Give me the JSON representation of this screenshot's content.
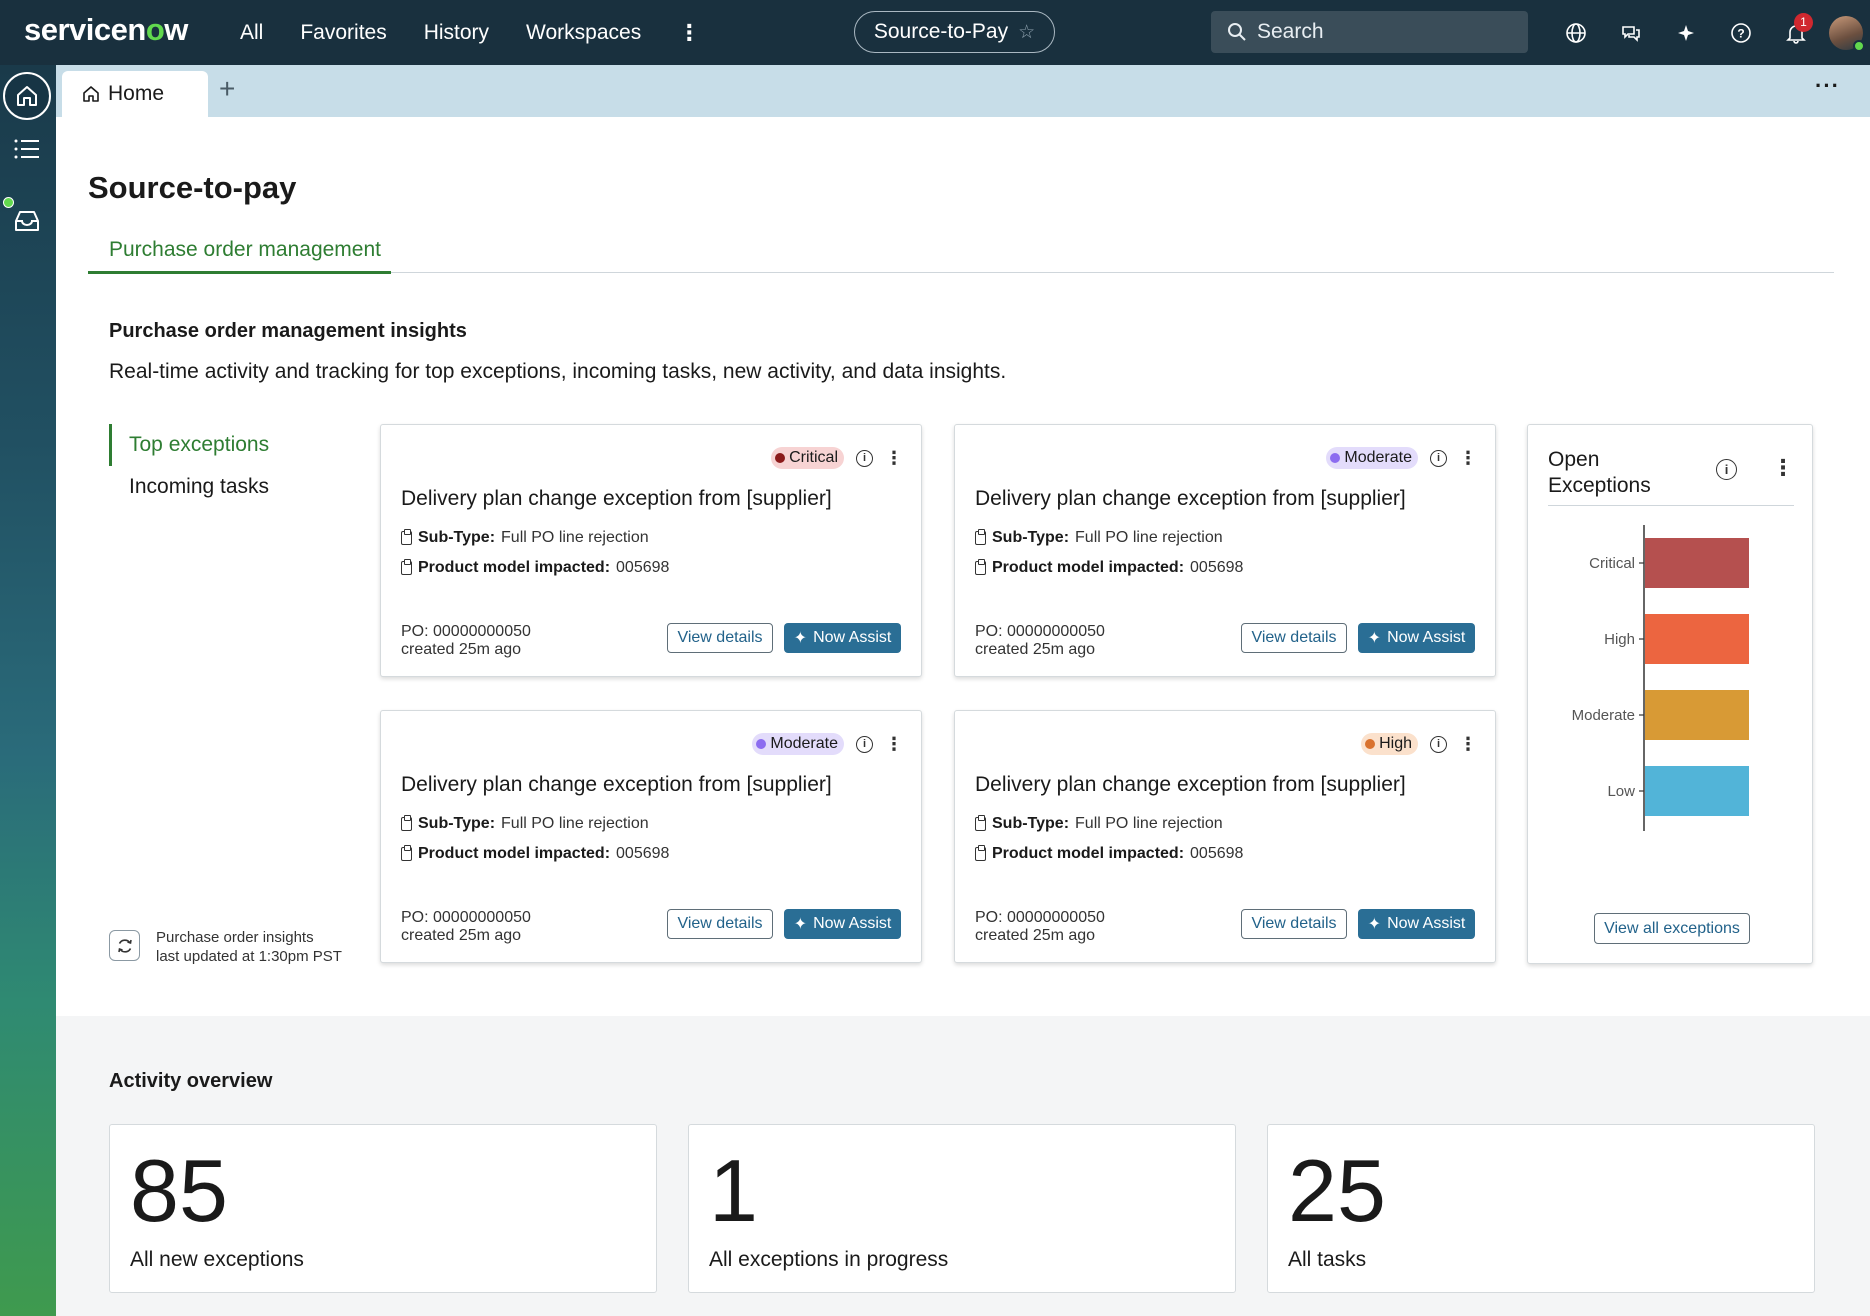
{
  "topbar": {
    "logo_pre": "servicen",
    "logo_o": "o",
    "logo_post": "w",
    "nav": [
      "All",
      "Favorites",
      "History",
      "Workspaces"
    ],
    "workspace": "Source-to-Pay",
    "search_placeholder": "Search",
    "notification_count": "1"
  },
  "tabs": {
    "home_label": "Home",
    "add_label": "+",
    "more_label": "···"
  },
  "page": {
    "title": "Source-to-pay",
    "subtab": "Purchase order management",
    "section_heading": "Purchase order management insights",
    "section_desc": "Real-time activity and tracking for top exceptions, incoming tasks, new activity, and data insights."
  },
  "side_nav": {
    "items": [
      "Top exceptions",
      "Incoming tasks"
    ],
    "refresh_line1": "Purchase order insights",
    "refresh_line2": "last updated at 1:30pm PST"
  },
  "exceptions": [
    {
      "severity": "Critical",
      "title": "Delivery plan change exception from [supplier]",
      "subtype_label": "Sub-Type:",
      "subtype": "Full PO line rejection",
      "product_label": "Product model impacted:",
      "product": "005698",
      "po": "PO: 00000000050",
      "created": "created 25m ago",
      "view_label": "View details",
      "assist_label": "Now Assist"
    },
    {
      "severity": "Moderate",
      "title": "Delivery plan change exception from [supplier]",
      "subtype_label": "Sub-Type:",
      "subtype": "Full PO line rejection",
      "product_label": "Product model impacted:",
      "product": "005698",
      "po": "PO: 00000000050",
      "created": "created 25m ago",
      "view_label": "View details",
      "assist_label": "Now Assist"
    },
    {
      "severity": "Moderate",
      "title": "Delivery plan change exception from [supplier]",
      "subtype_label": "Sub-Type:",
      "subtype": "Full PO line rejection",
      "product_label": "Product model impacted:",
      "product": "005698",
      "po": "PO: 00000000050",
      "created": "created 25m ago",
      "view_label": "View details",
      "assist_label": "Now Assist"
    },
    {
      "severity": "High",
      "title": "Delivery plan change exception from [supplier]",
      "subtype_label": "Sub-Type:",
      "subtype": "Full PO line rejection",
      "product_label": "Product model impacted:",
      "product": "005698",
      "po": "PO: 00000000050",
      "created": "created 25m ago",
      "view_label": "View details",
      "assist_label": "Now Assist"
    }
  ],
  "severity_colors": {
    "Critical": {
      "dot": "#8b1a1a",
      "bg": "#f7d3d3"
    },
    "Moderate": {
      "dot": "#8c6cf0",
      "bg": "#e3dcfb"
    },
    "High": {
      "dot": "#d9722e",
      "bg": "#fbe1cc"
    }
  },
  "open_exceptions": {
    "title": "Open Exceptions",
    "view_all_label": "View all exceptions"
  },
  "chart_data": {
    "type": "bar",
    "orientation": "horizontal",
    "categories": [
      "Critical",
      "High",
      "Moderate",
      "Low"
    ],
    "values": [
      1,
      1,
      1,
      1
    ],
    "colors": [
      "#b5504f",
      "#ec6540",
      "#d89a35",
      "#52b4d8"
    ],
    "title": "Open Exceptions",
    "xlabel": "",
    "ylabel": "",
    "grid": false
  },
  "activity": {
    "heading": "Activity overview",
    "stats": [
      {
        "value": "85",
        "label": "All new exceptions"
      },
      {
        "value": "1",
        "label": "All exceptions in progress"
      },
      {
        "value": "25",
        "label": "All tasks"
      }
    ]
  }
}
